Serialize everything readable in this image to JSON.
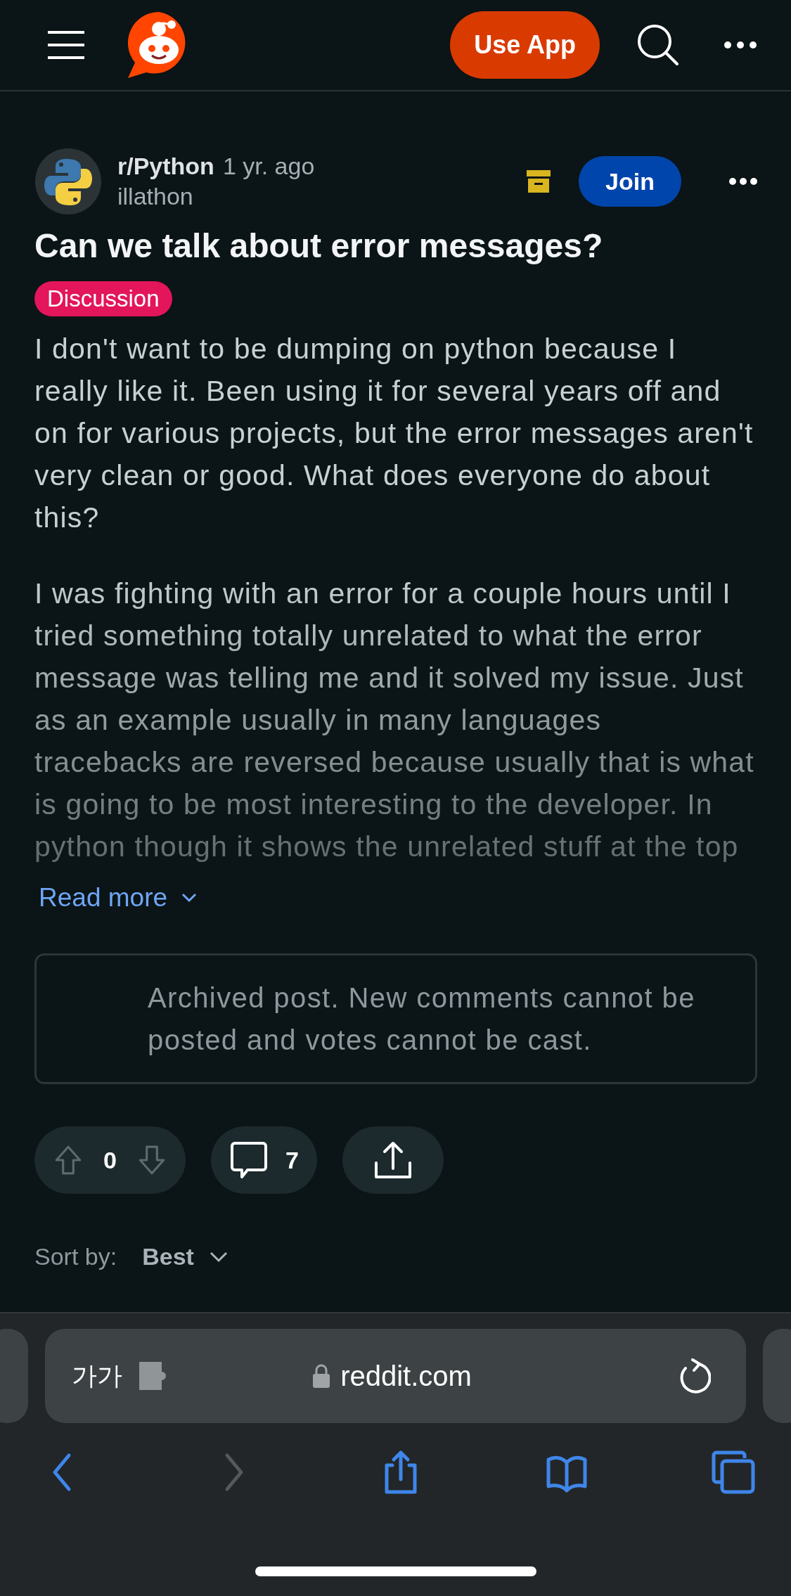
{
  "top_bar": {
    "use_app_button": "Use App"
  },
  "post": {
    "subreddit": "r/Python",
    "age": "1 yr. ago",
    "author": "illathon",
    "join_button": "Join",
    "archived": true,
    "title": "Can we talk about error messages?",
    "flair": {
      "label": "Discussion",
      "color": "#e3155b"
    },
    "paragraphs": [
      "I don't want to be dumping on python because I really like it. Been using it for several years off and on for various projects, but the error messages aren't very clean or good. What does everyone do about this?",
      "I was fighting with an error for a couple hours until I tried something totally unrelated to what the error message was telling me and it solved my issue. Just as an example usually in many languages tracebacks are reversed because usually that is what is going to be most interesting to the developer. In python though it shows the unrelated stuff at the top"
    ],
    "read_more": "Read more",
    "archived_notice": "Archived post. New comments cannot be posted and votes cannot be cast.",
    "votes": {
      "count": "0",
      "disabled": true
    },
    "comments": "7"
  },
  "sort": {
    "label": "Sort by:",
    "value": "Best"
  },
  "browser": {
    "text_size": "가가",
    "url": "reddit.com",
    "toolbar": [
      {
        "kind": "back",
        "disabled": false
      },
      {
        "kind": "forward",
        "disabled": true
      },
      {
        "kind": "share",
        "disabled": false
      },
      {
        "kind": "bookmarks",
        "disabled": false
      },
      {
        "kind": "tabs",
        "disabled": false
      }
    ]
  }
}
